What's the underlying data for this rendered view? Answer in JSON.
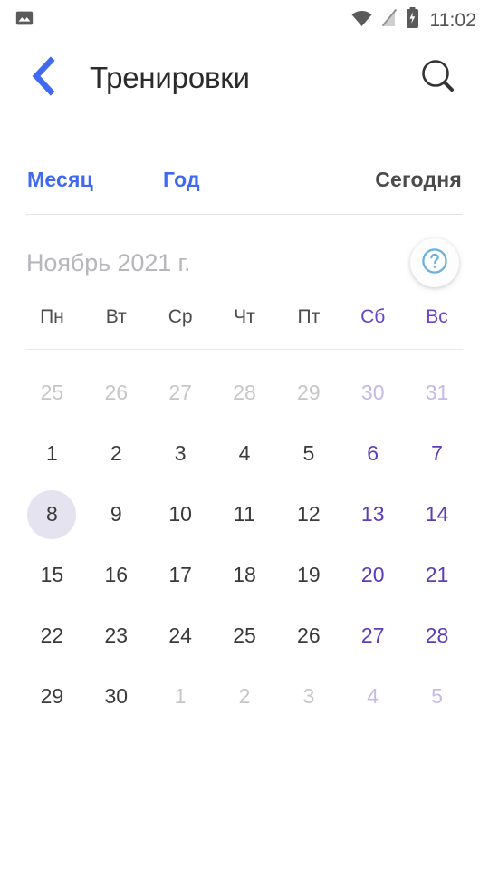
{
  "statusbar": {
    "time": "11:02",
    "icons": {
      "gallery": "image-icon",
      "wifi": "wifi-icon",
      "signal": "signal-off-icon",
      "battery": "battery-charging-icon"
    }
  },
  "appbar": {
    "back_icon": "chevron-left-icon",
    "title": "Тренировки",
    "search_icon": "search-icon"
  },
  "tabs": {
    "month": "Месяц",
    "year": "Год",
    "today": "Сегодня"
  },
  "calendar": {
    "month_label": "Ноябрь 2021 г.",
    "help_icon": "help-circle-icon",
    "weekdays": [
      {
        "label": "Пн",
        "weekend": false
      },
      {
        "label": "Вт",
        "weekend": false
      },
      {
        "label": "Ср",
        "weekend": false
      },
      {
        "label": "Чт",
        "weekend": false
      },
      {
        "label": "Пт",
        "weekend": false
      },
      {
        "label": "Сб",
        "weekend": true
      },
      {
        "label": "Вс",
        "weekend": true
      }
    ],
    "weeks": [
      [
        {
          "d": "25",
          "other": true,
          "weekend": false,
          "selected": false
        },
        {
          "d": "26",
          "other": true,
          "weekend": false,
          "selected": false
        },
        {
          "d": "27",
          "other": true,
          "weekend": false,
          "selected": false
        },
        {
          "d": "28",
          "other": true,
          "weekend": false,
          "selected": false
        },
        {
          "d": "29",
          "other": true,
          "weekend": false,
          "selected": false
        },
        {
          "d": "30",
          "other": true,
          "weekend": true,
          "selected": false
        },
        {
          "d": "31",
          "other": true,
          "weekend": true,
          "selected": false
        }
      ],
      [
        {
          "d": "1",
          "other": false,
          "weekend": false,
          "selected": false
        },
        {
          "d": "2",
          "other": false,
          "weekend": false,
          "selected": false
        },
        {
          "d": "3",
          "other": false,
          "weekend": false,
          "selected": false
        },
        {
          "d": "4",
          "other": false,
          "weekend": false,
          "selected": false
        },
        {
          "d": "5",
          "other": false,
          "weekend": false,
          "selected": false
        },
        {
          "d": "6",
          "other": false,
          "weekend": true,
          "selected": false
        },
        {
          "d": "7",
          "other": false,
          "weekend": true,
          "selected": false
        }
      ],
      [
        {
          "d": "8",
          "other": false,
          "weekend": false,
          "selected": true
        },
        {
          "d": "9",
          "other": false,
          "weekend": false,
          "selected": false
        },
        {
          "d": "10",
          "other": false,
          "weekend": false,
          "selected": false
        },
        {
          "d": "11",
          "other": false,
          "weekend": false,
          "selected": false
        },
        {
          "d": "12",
          "other": false,
          "weekend": false,
          "selected": false
        },
        {
          "d": "13",
          "other": false,
          "weekend": true,
          "selected": false
        },
        {
          "d": "14",
          "other": false,
          "weekend": true,
          "selected": false
        }
      ],
      [
        {
          "d": "15",
          "other": false,
          "weekend": false,
          "selected": false
        },
        {
          "d": "16",
          "other": false,
          "weekend": false,
          "selected": false
        },
        {
          "d": "17",
          "other": false,
          "weekend": false,
          "selected": false
        },
        {
          "d": "18",
          "other": false,
          "weekend": false,
          "selected": false
        },
        {
          "d": "19",
          "other": false,
          "weekend": false,
          "selected": false
        },
        {
          "d": "20",
          "other": false,
          "weekend": true,
          "selected": false
        },
        {
          "d": "21",
          "other": false,
          "weekend": true,
          "selected": false
        }
      ],
      [
        {
          "d": "22",
          "other": false,
          "weekend": false,
          "selected": false
        },
        {
          "d": "23",
          "other": false,
          "weekend": false,
          "selected": false
        },
        {
          "d": "24",
          "other": false,
          "weekend": false,
          "selected": false
        },
        {
          "d": "25",
          "other": false,
          "weekend": false,
          "selected": false
        },
        {
          "d": "26",
          "other": false,
          "weekend": false,
          "selected": false
        },
        {
          "d": "27",
          "other": false,
          "weekend": true,
          "selected": false
        },
        {
          "d": "28",
          "other": false,
          "weekend": true,
          "selected": false
        }
      ],
      [
        {
          "d": "29",
          "other": false,
          "weekend": false,
          "selected": false
        },
        {
          "d": "30",
          "other": false,
          "weekend": false,
          "selected": false
        },
        {
          "d": "1",
          "other": true,
          "weekend": false,
          "selected": false
        },
        {
          "d": "2",
          "other": true,
          "weekend": false,
          "selected": false
        },
        {
          "d": "3",
          "other": true,
          "weekend": false,
          "selected": false
        },
        {
          "d": "4",
          "other": true,
          "weekend": true,
          "selected": false
        },
        {
          "d": "5",
          "other": true,
          "weekend": true,
          "selected": false
        }
      ]
    ]
  },
  "colors": {
    "accent_blue": "#4169f0",
    "weekend_purple": "#5c3cbb",
    "selected_bg": "#e6e3f1",
    "help_blue": "#6cb0dc",
    "text_dark": "#3a3a3a",
    "text_muted": "#b6b6bb"
  }
}
